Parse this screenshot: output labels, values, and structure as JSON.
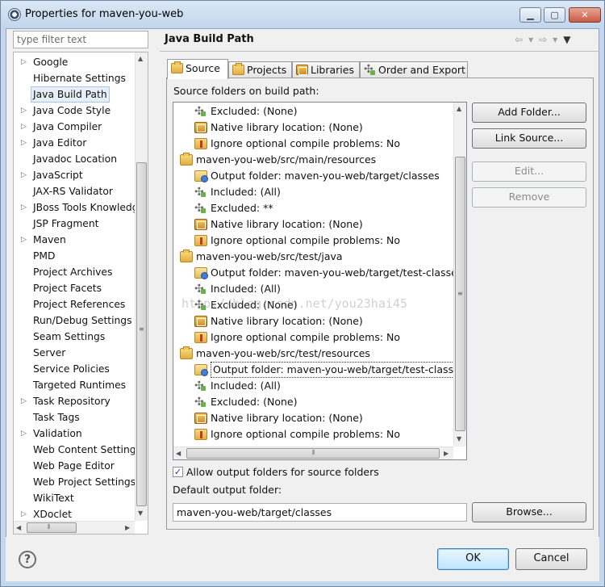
{
  "window": {
    "title": "Properties for maven-you-web",
    "controls": {
      "minimize": "▁",
      "maximize": "▢",
      "close": "✕"
    }
  },
  "filter": {
    "placeholder": "type filter text",
    "value": ""
  },
  "tree": {
    "items": [
      {
        "label": "Google",
        "expandable": true
      },
      {
        "label": "Hibernate Settings",
        "expandable": false
      },
      {
        "label": "Java Build Path",
        "expandable": false,
        "selected": true
      },
      {
        "label": "Java Code Style",
        "expandable": true
      },
      {
        "label": "Java Compiler",
        "expandable": true
      },
      {
        "label": "Java Editor",
        "expandable": true
      },
      {
        "label": "Javadoc Location",
        "expandable": false
      },
      {
        "label": "JavaScript",
        "expandable": true
      },
      {
        "label": "JAX-RS Validator",
        "expandable": false
      },
      {
        "label": "JBoss Tools Knowledge",
        "expandable": true
      },
      {
        "label": "JSP Fragment",
        "expandable": false
      },
      {
        "label": "Maven",
        "expandable": true
      },
      {
        "label": "PMD",
        "expandable": false
      },
      {
        "label": "Project Archives",
        "expandable": false
      },
      {
        "label": "Project Facets",
        "expandable": false
      },
      {
        "label": "Project References",
        "expandable": false
      },
      {
        "label": "Run/Debug Settings",
        "expandable": false
      },
      {
        "label": "Seam Settings",
        "expandable": false
      },
      {
        "label": "Server",
        "expandable": false
      },
      {
        "label": "Service Policies",
        "expandable": false
      },
      {
        "label": "Targeted Runtimes",
        "expandable": false
      },
      {
        "label": "Task Repository",
        "expandable": true
      },
      {
        "label": "Task Tags",
        "expandable": false
      },
      {
        "label": "Validation",
        "expandable": true
      },
      {
        "label": "Web Content Settings",
        "expandable": false
      },
      {
        "label": "Web Page Editor",
        "expandable": false
      },
      {
        "label": "Web Project Settings",
        "expandable": false
      },
      {
        "label": "WikiText",
        "expandable": false
      },
      {
        "label": "XDoclet",
        "expandable": true
      }
    ]
  },
  "header": {
    "title": "Java Build Path",
    "nav": {
      "back": "⇦",
      "back_menu": "▾",
      "forward": "⇨",
      "forward_menu": "▾",
      "view_menu": "▼"
    }
  },
  "tabs": [
    {
      "label": "Source",
      "icon": "source-folder-icon",
      "active": true
    },
    {
      "label": "Projects",
      "icon": "projects-icon",
      "active": false
    },
    {
      "label": "Libraries",
      "icon": "libraries-icon",
      "active": false
    },
    {
      "label": "Order and Export",
      "icon": "order-export-icon",
      "active": false
    }
  ],
  "source": {
    "label": "Source folders on build path:",
    "rows": [
      {
        "text": "Excluded: (None)",
        "icon": "filter",
        "level": 1
      },
      {
        "text": "Native library location: (None)",
        "icon": "lib",
        "level": 1
      },
      {
        "text": "Ignore optional compile problems: No",
        "icon": "ignore",
        "level": 1
      },
      {
        "text": "maven-you-web/src/main/resources",
        "icon": "folder",
        "level": 0
      },
      {
        "text": "Output folder: maven-you-web/target/classes",
        "icon": "out",
        "level": 1
      },
      {
        "text": "Included: (All)",
        "icon": "filter",
        "level": 1
      },
      {
        "text": "Excluded: **",
        "icon": "filter",
        "level": 1
      },
      {
        "text": "Native library location: (None)",
        "icon": "lib",
        "level": 1
      },
      {
        "text": "Ignore optional compile problems: No",
        "icon": "ignore",
        "level": 1
      },
      {
        "text": "maven-you-web/src/test/java",
        "icon": "folder",
        "level": 0
      },
      {
        "text": "Output folder: maven-you-web/target/test-classes",
        "icon": "out",
        "level": 1
      },
      {
        "text": "Included: (All)",
        "icon": "filter",
        "level": 1
      },
      {
        "text": "Excluded: (None)",
        "icon": "filter",
        "level": 1
      },
      {
        "text": "Native library location: (None)",
        "icon": "lib",
        "level": 1
      },
      {
        "text": "Ignore optional compile problems: No",
        "icon": "ignore",
        "level": 1
      },
      {
        "text": "maven-you-web/src/test/resources",
        "icon": "folder",
        "level": 0
      },
      {
        "text": "Output folder: maven-you-web/target/test-classes",
        "icon": "out",
        "level": 1,
        "focused": true
      },
      {
        "text": "Included: (All)",
        "icon": "filter",
        "level": 1
      },
      {
        "text": "Excluded: (None)",
        "icon": "filter",
        "level": 1
      },
      {
        "text": "Native library location: (None)",
        "icon": "lib",
        "level": 1
      },
      {
        "text": "Ignore optional compile problems: No",
        "icon": "ignore",
        "level": 1
      }
    ]
  },
  "buttons": {
    "add_folder": "Add Folder...",
    "link_source": "Link Source...",
    "edit": "Edit...",
    "remove": "Remove",
    "browse": "Browse...",
    "ok": "OK",
    "cancel": "Cancel",
    "help": "?"
  },
  "options": {
    "allow_output_folders": {
      "label": "Allow output folders for source folders",
      "checked": true
    },
    "default_output_label": "Default output folder:",
    "default_output_value": "maven-you-web/target/classes"
  },
  "watermark": "http://blog.csdn.net/you23hai45",
  "colors": {
    "title_bar": "#c2d6ec",
    "ok_button": "#bee6fd",
    "selection": "#e7eef7"
  }
}
